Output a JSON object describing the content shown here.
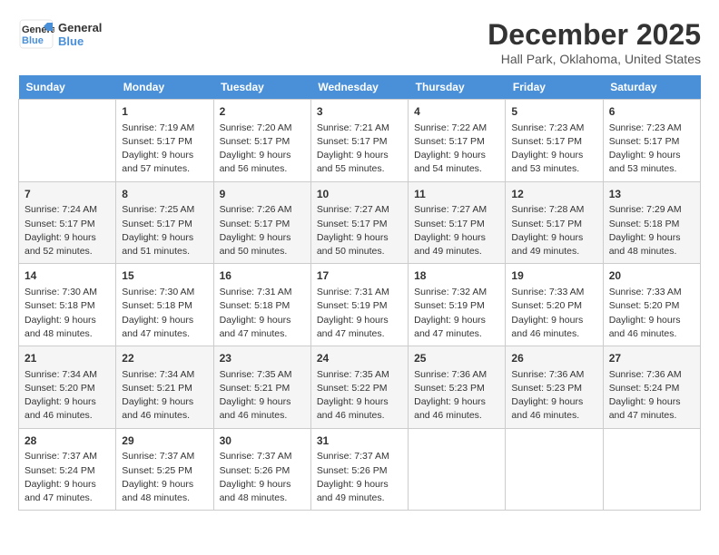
{
  "header": {
    "logo_line1": "General",
    "logo_line2": "Blue",
    "month": "December 2025",
    "location": "Hall Park, Oklahoma, United States"
  },
  "days_of_week": [
    "Sunday",
    "Monday",
    "Tuesday",
    "Wednesday",
    "Thursday",
    "Friday",
    "Saturday"
  ],
  "weeks": [
    [
      {
        "day": "",
        "empty": true
      },
      {
        "day": "1",
        "sunrise": "Sunrise: 7:19 AM",
        "sunset": "Sunset: 5:17 PM",
        "daylight": "Daylight: 9 hours and 57 minutes."
      },
      {
        "day": "2",
        "sunrise": "Sunrise: 7:20 AM",
        "sunset": "Sunset: 5:17 PM",
        "daylight": "Daylight: 9 hours and 56 minutes."
      },
      {
        "day": "3",
        "sunrise": "Sunrise: 7:21 AM",
        "sunset": "Sunset: 5:17 PM",
        "daylight": "Daylight: 9 hours and 55 minutes."
      },
      {
        "day": "4",
        "sunrise": "Sunrise: 7:22 AM",
        "sunset": "Sunset: 5:17 PM",
        "daylight": "Daylight: 9 hours and 54 minutes."
      },
      {
        "day": "5",
        "sunrise": "Sunrise: 7:23 AM",
        "sunset": "Sunset: 5:17 PM",
        "daylight": "Daylight: 9 hours and 53 minutes."
      },
      {
        "day": "6",
        "sunrise": "Sunrise: 7:23 AM",
        "sunset": "Sunset: 5:17 PM",
        "daylight": "Daylight: 9 hours and 53 minutes."
      }
    ],
    [
      {
        "day": "7",
        "sunrise": "Sunrise: 7:24 AM",
        "sunset": "Sunset: 5:17 PM",
        "daylight": "Daylight: 9 hours and 52 minutes."
      },
      {
        "day": "8",
        "sunrise": "Sunrise: 7:25 AM",
        "sunset": "Sunset: 5:17 PM",
        "daylight": "Daylight: 9 hours and 51 minutes."
      },
      {
        "day": "9",
        "sunrise": "Sunrise: 7:26 AM",
        "sunset": "Sunset: 5:17 PM",
        "daylight": "Daylight: 9 hours and 50 minutes."
      },
      {
        "day": "10",
        "sunrise": "Sunrise: 7:27 AM",
        "sunset": "Sunset: 5:17 PM",
        "daylight": "Daylight: 9 hours and 50 minutes."
      },
      {
        "day": "11",
        "sunrise": "Sunrise: 7:27 AM",
        "sunset": "Sunset: 5:17 PM",
        "daylight": "Daylight: 9 hours and 49 minutes."
      },
      {
        "day": "12",
        "sunrise": "Sunrise: 7:28 AM",
        "sunset": "Sunset: 5:17 PM",
        "daylight": "Daylight: 9 hours and 49 minutes."
      },
      {
        "day": "13",
        "sunrise": "Sunrise: 7:29 AM",
        "sunset": "Sunset: 5:18 PM",
        "daylight": "Daylight: 9 hours and 48 minutes."
      }
    ],
    [
      {
        "day": "14",
        "sunrise": "Sunrise: 7:30 AM",
        "sunset": "Sunset: 5:18 PM",
        "daylight": "Daylight: 9 hours and 48 minutes."
      },
      {
        "day": "15",
        "sunrise": "Sunrise: 7:30 AM",
        "sunset": "Sunset: 5:18 PM",
        "daylight": "Daylight: 9 hours and 47 minutes."
      },
      {
        "day": "16",
        "sunrise": "Sunrise: 7:31 AM",
        "sunset": "Sunset: 5:18 PM",
        "daylight": "Daylight: 9 hours and 47 minutes."
      },
      {
        "day": "17",
        "sunrise": "Sunrise: 7:31 AM",
        "sunset": "Sunset: 5:19 PM",
        "daylight": "Daylight: 9 hours and 47 minutes."
      },
      {
        "day": "18",
        "sunrise": "Sunrise: 7:32 AM",
        "sunset": "Sunset: 5:19 PM",
        "daylight": "Daylight: 9 hours and 47 minutes."
      },
      {
        "day": "19",
        "sunrise": "Sunrise: 7:33 AM",
        "sunset": "Sunset: 5:20 PM",
        "daylight": "Daylight: 9 hours and 46 minutes."
      },
      {
        "day": "20",
        "sunrise": "Sunrise: 7:33 AM",
        "sunset": "Sunset: 5:20 PM",
        "daylight": "Daylight: 9 hours and 46 minutes."
      }
    ],
    [
      {
        "day": "21",
        "sunrise": "Sunrise: 7:34 AM",
        "sunset": "Sunset: 5:20 PM",
        "daylight": "Daylight: 9 hours and 46 minutes."
      },
      {
        "day": "22",
        "sunrise": "Sunrise: 7:34 AM",
        "sunset": "Sunset: 5:21 PM",
        "daylight": "Daylight: 9 hours and 46 minutes."
      },
      {
        "day": "23",
        "sunrise": "Sunrise: 7:35 AM",
        "sunset": "Sunset: 5:21 PM",
        "daylight": "Daylight: 9 hours and 46 minutes."
      },
      {
        "day": "24",
        "sunrise": "Sunrise: 7:35 AM",
        "sunset": "Sunset: 5:22 PM",
        "daylight": "Daylight: 9 hours and 46 minutes."
      },
      {
        "day": "25",
        "sunrise": "Sunrise: 7:36 AM",
        "sunset": "Sunset: 5:23 PM",
        "daylight": "Daylight: 9 hours and 46 minutes."
      },
      {
        "day": "26",
        "sunrise": "Sunrise: 7:36 AM",
        "sunset": "Sunset: 5:23 PM",
        "daylight": "Daylight: 9 hours and 46 minutes."
      },
      {
        "day": "27",
        "sunrise": "Sunrise: 7:36 AM",
        "sunset": "Sunset: 5:24 PM",
        "daylight": "Daylight: 9 hours and 47 minutes."
      }
    ],
    [
      {
        "day": "28",
        "sunrise": "Sunrise: 7:37 AM",
        "sunset": "Sunset: 5:24 PM",
        "daylight": "Daylight: 9 hours and 47 minutes."
      },
      {
        "day": "29",
        "sunrise": "Sunrise: 7:37 AM",
        "sunset": "Sunset: 5:25 PM",
        "daylight": "Daylight: 9 hours and 48 minutes."
      },
      {
        "day": "30",
        "sunrise": "Sunrise: 7:37 AM",
        "sunset": "Sunset: 5:26 PM",
        "daylight": "Daylight: 9 hours and 48 minutes."
      },
      {
        "day": "31",
        "sunrise": "Sunrise: 7:37 AM",
        "sunset": "Sunset: 5:26 PM",
        "daylight": "Daylight: 9 hours and 49 minutes."
      },
      {
        "day": "",
        "empty": true
      },
      {
        "day": "",
        "empty": true
      },
      {
        "day": "",
        "empty": true
      }
    ]
  ]
}
